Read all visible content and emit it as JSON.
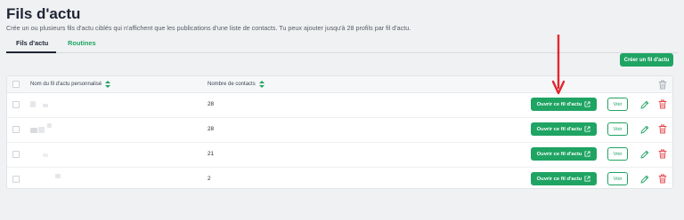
{
  "page": {
    "title": "Fils d'actu",
    "subtitle": "Crée un ou plusieurs fils d'actu ciblés qui n'affichent que les publications d'une liste de contacts. Tu peux ajouter jusqu'à 28 profils par fil d'actu."
  },
  "tabs": [
    {
      "label": "Fils d'actu",
      "active": true
    },
    {
      "label": "Routines",
      "active": false
    }
  ],
  "actions": {
    "create_label": "Créer un fil d'actu"
  },
  "table": {
    "columns": {
      "name": "Nom du fil d'actu personnalisé",
      "contacts": "Nombre de contacts"
    },
    "rows": [
      {
        "contacts": "28",
        "open_label": "Ouvrir ce fil d'actu",
        "view_label": "Voir"
      },
      {
        "contacts": "28",
        "open_label": "Ouvrir ce fil d'actu",
        "view_label": "Voir"
      },
      {
        "contacts": "21",
        "open_label": "Ouvrir ce fil d'actu",
        "view_label": "Voir"
      },
      {
        "contacts": "2",
        "open_label": "Ouvrir ce fil d'actu",
        "view_label": "Voir"
      }
    ]
  },
  "colors": {
    "accent": "#1fa463",
    "danger": "#e5484d",
    "annotation": "#e0282e",
    "background": "#f0f1f3"
  },
  "icons": [
    "sort-icon",
    "external-link-icon",
    "pencil-icon",
    "trash-icon",
    "red-arrow-annotation"
  ]
}
